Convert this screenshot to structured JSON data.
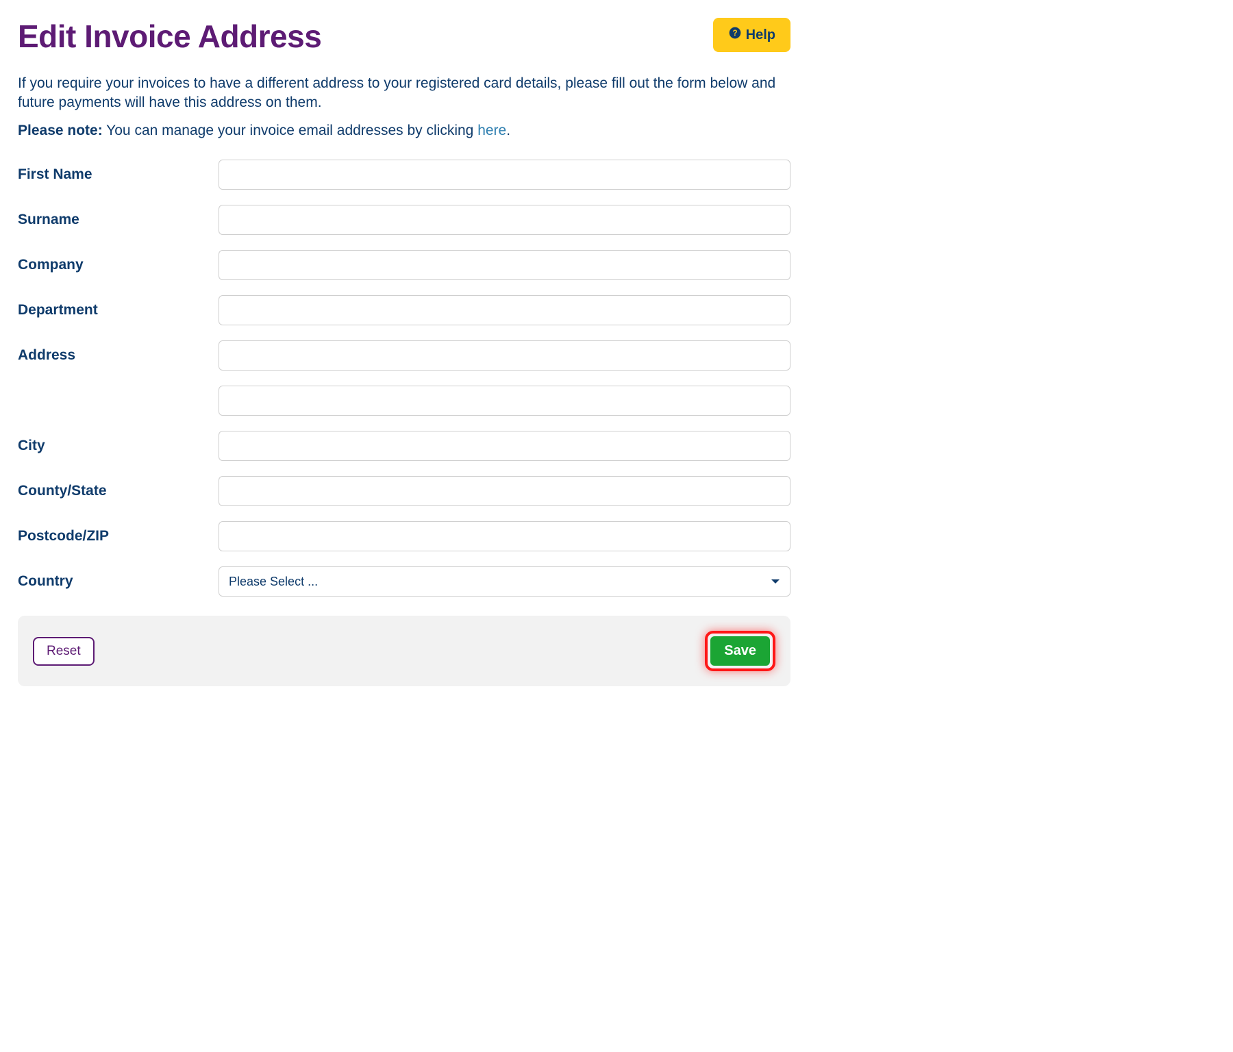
{
  "header": {
    "title": "Edit Invoice Address",
    "help_label": "Help"
  },
  "intro": "If you require your invoices to have a different address to your registered card details, please fill out the form below and future payments will have this address on them.",
  "note": {
    "prefix": "Please note:",
    "text": " You can manage your invoice email addresses by clicking ",
    "link": "here",
    "suffix": "."
  },
  "form": {
    "first_name": {
      "label": "First Name",
      "value": ""
    },
    "surname": {
      "label": "Surname",
      "value": ""
    },
    "company": {
      "label": "Company",
      "value": ""
    },
    "department": {
      "label": "Department",
      "value": ""
    },
    "address": {
      "label": "Address",
      "value": ""
    },
    "address2": {
      "label": "",
      "value": ""
    },
    "city": {
      "label": "City",
      "value": ""
    },
    "county": {
      "label": "County/State",
      "value": ""
    },
    "postcode": {
      "label": "Postcode/ZIP",
      "value": ""
    },
    "country": {
      "label": "Country",
      "value": "Please Select ...",
      "options": [
        "Please Select ..."
      ]
    }
  },
  "buttons": {
    "reset": "Reset",
    "save": "Save"
  }
}
